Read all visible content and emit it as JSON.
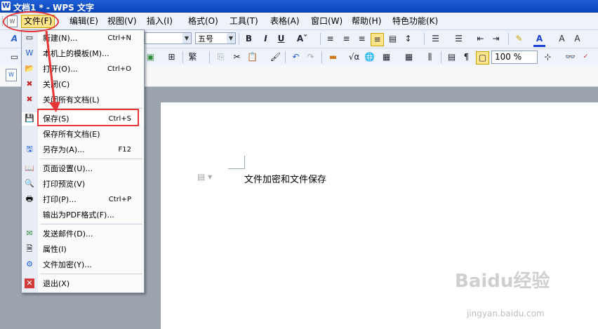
{
  "window": {
    "title": "文档1 * - WPS 文字"
  },
  "menubar": {
    "items": [
      "文件(F)",
      "编辑(E)",
      "视图(V)",
      "插入(I)",
      "格式(O)",
      "工具(T)",
      "表格(A)",
      "窗口(W)",
      "帮助(H)",
      "特色功能(K)"
    ],
    "active": "文件(F)"
  },
  "toolbar": {
    "font_size": "五号",
    "bold": "B",
    "italic": "I",
    "underline": "U",
    "font_color_label": "A",
    "zoom": "100 %"
  },
  "file_menu": {
    "items": [
      {
        "icon": "new-doc",
        "label": "新建(N)...",
        "shortcut": "Ctrl+N"
      },
      {
        "icon": "template",
        "label": "本机上的模板(M)...",
        "shortcut": ""
      },
      {
        "icon": "open-folder",
        "label": "打开(O)...",
        "shortcut": "Ctrl+O"
      },
      {
        "icon": "close-doc",
        "label": "关闭(C)",
        "shortcut": ""
      },
      {
        "icon": "close-all",
        "label": "关闭所有文档(L)",
        "shortcut": ""
      },
      {
        "icon": "save",
        "label": "保存(S)",
        "shortcut": "Ctrl+S"
      },
      {
        "icon": "",
        "label": "保存所有文档(E)",
        "shortcut": ""
      },
      {
        "icon": "save-as",
        "label": "另存为(A)...",
        "shortcut": "F12"
      },
      {
        "icon": "page-setup",
        "label": "页面设置(U)...",
        "shortcut": ""
      },
      {
        "icon": "print-preview",
        "label": "打印预览(V)",
        "shortcut": ""
      },
      {
        "icon": "print",
        "label": "打印(P)...",
        "shortcut": "Ctrl+P"
      },
      {
        "icon": "",
        "label": "输出为PDF格式(F)...",
        "shortcut": ""
      },
      {
        "icon": "send-mail",
        "label": "发送邮件(D)...",
        "shortcut": ""
      },
      {
        "icon": "properties",
        "label": "属性(I)",
        "shortcut": ""
      },
      {
        "icon": "encrypt",
        "label": "文件加密(Y)...",
        "shortcut": ""
      },
      {
        "icon": "exit",
        "label": "退出(X)",
        "shortcut": ""
      }
    ]
  },
  "document": {
    "text": "文件加密和文件保存"
  },
  "watermark": {
    "brand": "Baidu经验",
    "url": "jingyan.baidu.com"
  },
  "colors": {
    "highlight_red": "#e63535",
    "title_blue": "#0a43b8"
  }
}
